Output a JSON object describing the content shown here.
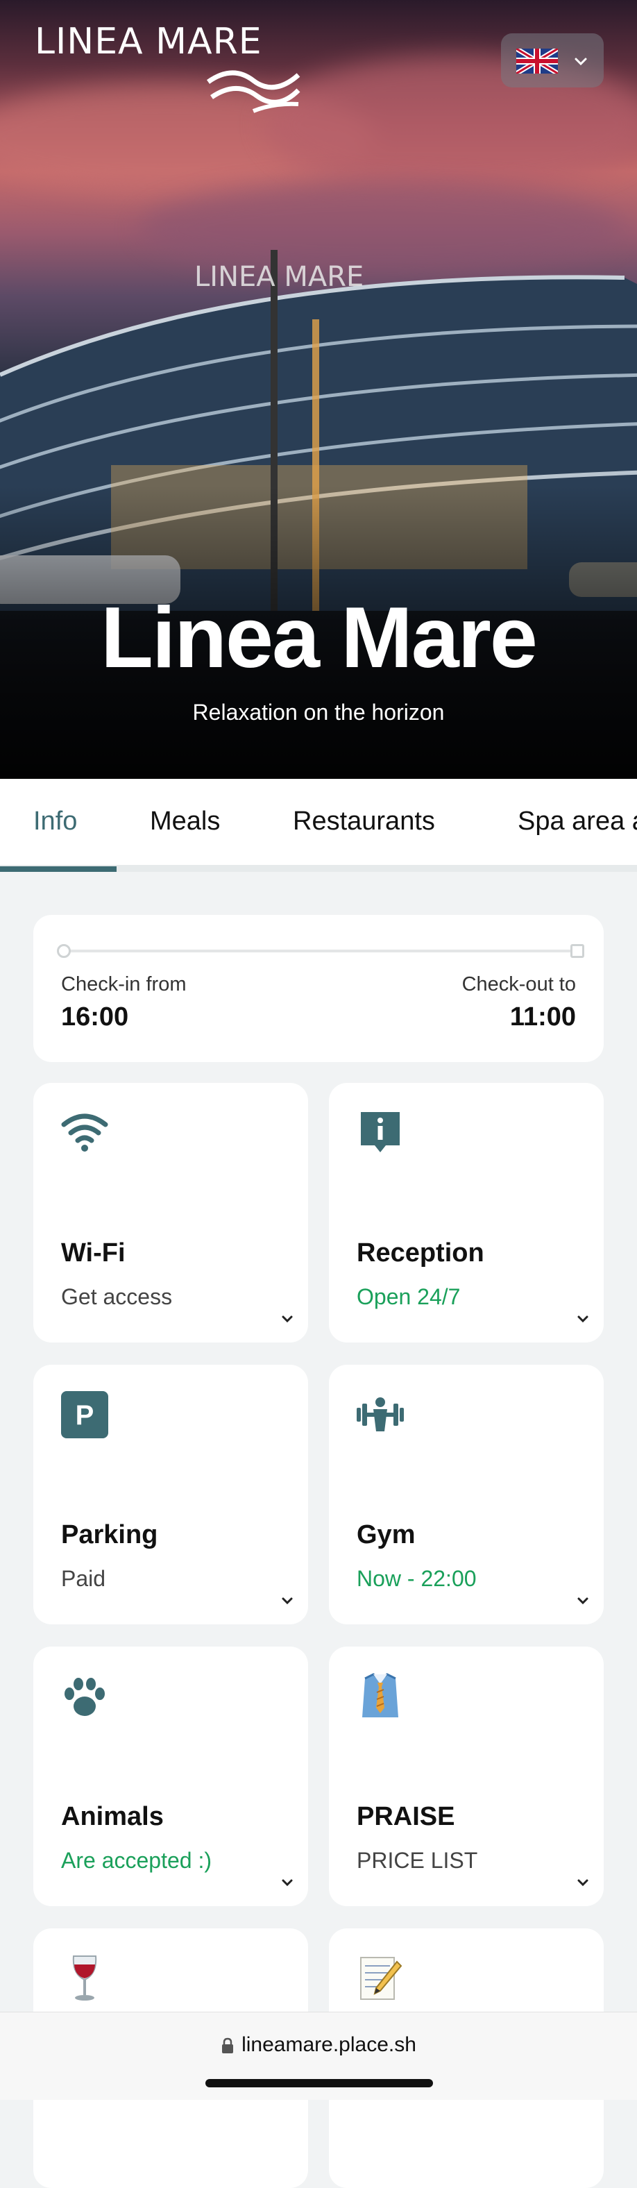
{
  "brand": {
    "logo_text": "LINEA MARE",
    "hero_title": "Linea Mare",
    "hero_subtitle": "Relaxation on the horizon",
    "accent_color": "#3d6b73",
    "green_color": "#1aa05a"
  },
  "language": {
    "selected": "uk-flag-icon"
  },
  "tabs": [
    {
      "label": "Info",
      "active": true
    },
    {
      "label": "Meals"
    },
    {
      "label": "Restaurants"
    },
    {
      "label": "Spa area a"
    }
  ],
  "checkin": {
    "in_label": "Check-in from",
    "in_time": "16:00",
    "out_label": "Check-out to",
    "out_time": "11:00"
  },
  "tiles": [
    {
      "icon": "wifi-icon",
      "title": "Wi-Fi",
      "subtitle": "Get access"
    },
    {
      "icon": "info-icon",
      "title": "Reception",
      "subtitle": "Open 24/7"
    },
    {
      "icon": "parking-icon",
      "title": "Parking",
      "subtitle": "Paid"
    },
    {
      "icon": "gym-icon",
      "title": "Gym",
      "subtitle": "Now - 22:00"
    },
    {
      "icon": "paw-icon",
      "title": "Animals",
      "subtitle": "Are accepted :)"
    },
    {
      "icon": "shirt-tie-icon",
      "title": "PRAISE",
      "subtitle": "PRICE LIST"
    },
    {
      "icon": "wine-glass-icon"
    },
    {
      "icon": "memo-icon"
    }
  ],
  "browser": {
    "url": "lineamare.place.sh"
  }
}
